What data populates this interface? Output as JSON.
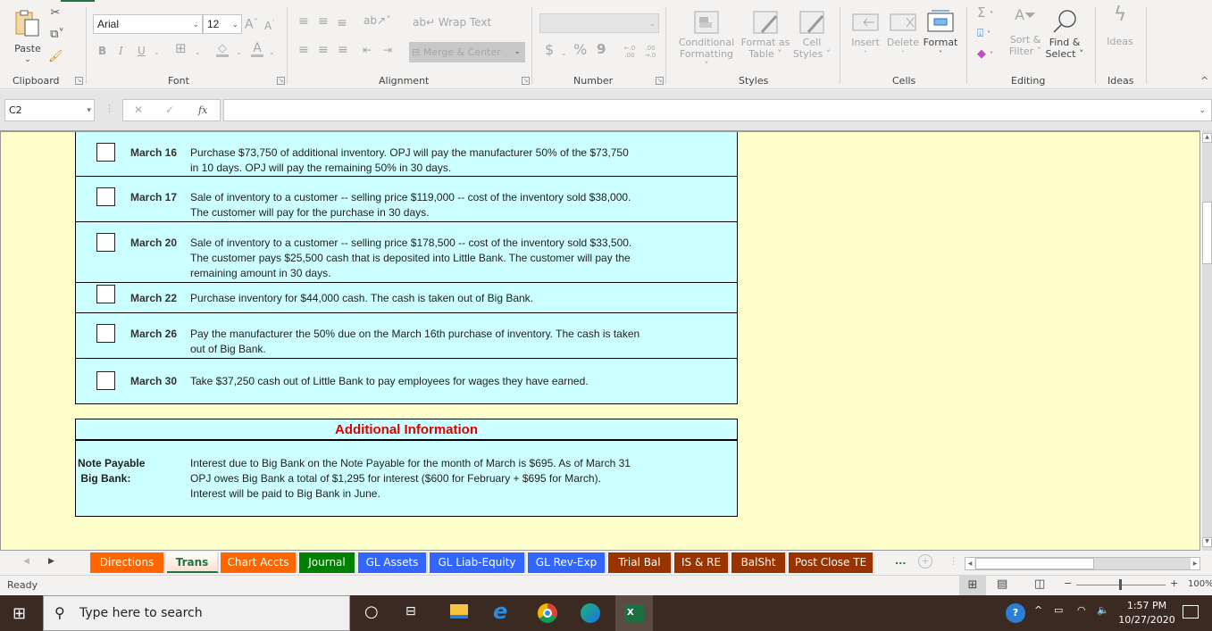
{
  "ribbon": {
    "clipboard": {
      "paste_label": "Paste",
      "group_label": "Clipboard"
    },
    "font": {
      "font_name": "Arial",
      "font_size": "12",
      "group_label": "Font",
      "bold": "B",
      "italic": "I",
      "underline": "U"
    },
    "alignment": {
      "wrap_text": "Wrap Text",
      "merge_center": "Merge & Center",
      "group_label": "Alignment"
    },
    "number": {
      "format_value": "",
      "currency": "$",
      "percent": "%",
      "comma": "9",
      "inc_decimal": "←.0 .00",
      "dec_decimal": ".00 →.0",
      "group_label": "Number"
    },
    "styles": {
      "conditional_formatting": [
        "Conditional",
        "Formatting"
      ],
      "format_as_table": [
        "Format as",
        "Table"
      ],
      "cell_styles": [
        "Cell",
        "Styles"
      ],
      "group_label": "Styles"
    },
    "cells": {
      "insert": "Insert",
      "delete": "Delete",
      "format": "Format",
      "group_label": "Cells"
    },
    "editing": {
      "sort_filter": [
        "Sort &",
        "Filter"
      ],
      "find_select": [
        "Find &",
        "Select"
      ],
      "group_label": "Editing"
    },
    "ideas": {
      "label": "Ideas",
      "group_label": "Ideas"
    }
  },
  "formula_bar": {
    "name_box": "C2",
    "cancel": "✕",
    "enter": "✓",
    "fx": "fx",
    "formula": ""
  },
  "transactions": [
    {
      "date": "March 16",
      "lines": [
        "Purchase $73,750 of additional inventory.  OPJ will pay the manufacturer 50% of the $73,750",
        "in 10 days.  OPJ will pay the remaining 50% in 30 days."
      ]
    },
    {
      "date": "March 17",
      "lines": [
        "Sale of inventory to a customer -- selling price  $119,000 -- cost of the inventory sold $38,000.",
        "The customer will pay for the purchase in 30 days."
      ]
    },
    {
      "date": "March 20",
      "lines": [
        "Sale of inventory to a customer -- selling price $178,500 -- cost of the inventory sold $33,500.",
        "The customer pays $25,500 cash that is deposited into Little Bank.  The customer will pay the",
        "remaining amount in 30 days."
      ]
    },
    {
      "date": "March 22",
      "lines": [
        "Purchase inventory for $44,000 cash.  The cash is taken out of Big Bank."
      ]
    },
    {
      "date": "March 26",
      "lines": [
        "Pay the manufacturer the 50% due on the March 16th purchase of inventory.  The cash is taken",
        "out of Big Bank."
      ]
    },
    {
      "date": "March 30",
      "lines": [
        "Take $37,250 cash out of Little Bank to pay employees for wages they have earned."
      ]
    }
  ],
  "additional_info": {
    "title": "Additional Information",
    "label_line1": "Note Payable",
    "label_line2": " Big Bank:",
    "lines": [
      "Interest due to Big Bank on the Note Payable for the month of March is  $695.  As of March 31",
      "OPJ owes Big Bank a total of  $1,295 for interest ($600 for February +  $695 for March).",
      "Interest will be paid to Big Bank in June."
    ]
  },
  "sheet_tabs": [
    {
      "label": "Directions",
      "color": "#ff6600",
      "active": false
    },
    {
      "label": "Trans",
      "color": "#fbe0cf",
      "active": true
    },
    {
      "label": "Chart Accts",
      "color": "#ff6600",
      "active": false
    },
    {
      "label": "Journal",
      "color": "#008000",
      "active": false
    },
    {
      "label": "GL Assets",
      "color": "#3366ff",
      "active": false
    },
    {
      "label": "GL Liab-Equity",
      "color": "#3366ff",
      "active": false
    },
    {
      "label": "GL Rev-Exp",
      "color": "#3366ff",
      "active": false
    },
    {
      "label": "Trial Bal",
      "color": "#993300",
      "active": false
    },
    {
      "label": "IS & RE",
      "color": "#993300",
      "active": false
    },
    {
      "label": "BalSht",
      "color": "#993300",
      "active": false
    },
    {
      "label": "Post Close TE",
      "color": "#993300",
      "active": false
    }
  ],
  "sheet_tabs_more": "...",
  "status": {
    "ready": "Ready",
    "zoom": "100%"
  },
  "taskbar": {
    "search_placeholder": "Type here to search",
    "time": "1:57 PM",
    "date": "10/27/2020"
  }
}
